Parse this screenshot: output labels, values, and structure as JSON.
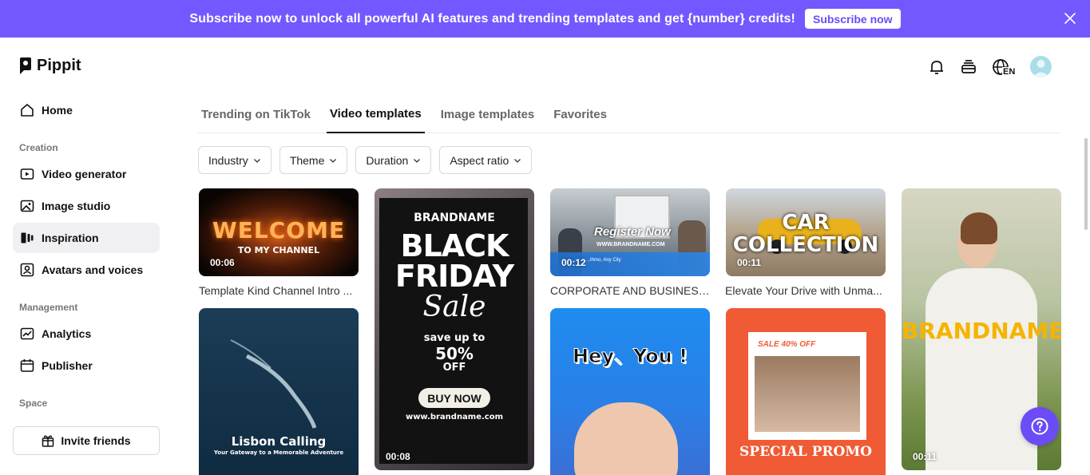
{
  "banner": {
    "text": "Subscribe now to unlock all powerful AI features and trending templates and get {number} credits!",
    "button": "Subscribe now"
  },
  "app": {
    "name": "Pippit"
  },
  "sidebar": {
    "home": "Home",
    "creation_label": "Creation",
    "video_generator": "Video generator",
    "image_studio": "Image studio",
    "inspiration": "Inspiration",
    "avatars": "Avatars and voices",
    "management_label": "Management",
    "analytics": "Analytics",
    "publisher": "Publisher",
    "space_label": "Space",
    "invite": "Invite friends"
  },
  "header": {
    "language": "EN"
  },
  "tabs": [
    "Trending on TikTok",
    "Video templates",
    "Image templates",
    "Favorites"
  ],
  "filters": [
    "Industry",
    "Theme",
    "Duration",
    "Aspect ratio"
  ],
  "cards": {
    "c1": {
      "title": "WELCOME",
      "sub": "TO MY CHANNEL",
      "duration": "00:06",
      "caption": "Template Kind Channel Intro ..."
    },
    "c2": {
      "brand": "BRANDNAME",
      "line1": "BLACK",
      "line2": "FRIDAY",
      "sale": "Sale",
      "save": "save up to",
      "pct": "50%",
      "off": "OFF",
      "buy": "BUY NOW",
      "url": "www.brandname.com",
      "duration": "00:08"
    },
    "c3": {
      "title": "Register Now",
      "sub": "WWW.BRANDNAME.COM",
      "addr": "...thmo, Any City",
      "duration": "00:12",
      "caption": "CORPORATE AND BUSINESS ..."
    },
    "c4": {
      "line1": "CAR",
      "line2": "COLLECTION",
      "duration": "00:11",
      "caption": "Elevate Your Drive with Unma..."
    },
    "c5": {
      "brand": "BRANDNAME",
      "duration": "00:11"
    },
    "c6": {
      "title": "Lisbon Calling",
      "sub": "Your Gateway to a Memorable Adventure"
    },
    "c7": {
      "title": "Hey、You !"
    },
    "c8": {
      "badge": "SALE 40% OFF",
      "title": "SPECIAL PROMO"
    }
  },
  "colors": {
    "accent": "#7458ff",
    "help": "#6b4cf6"
  }
}
